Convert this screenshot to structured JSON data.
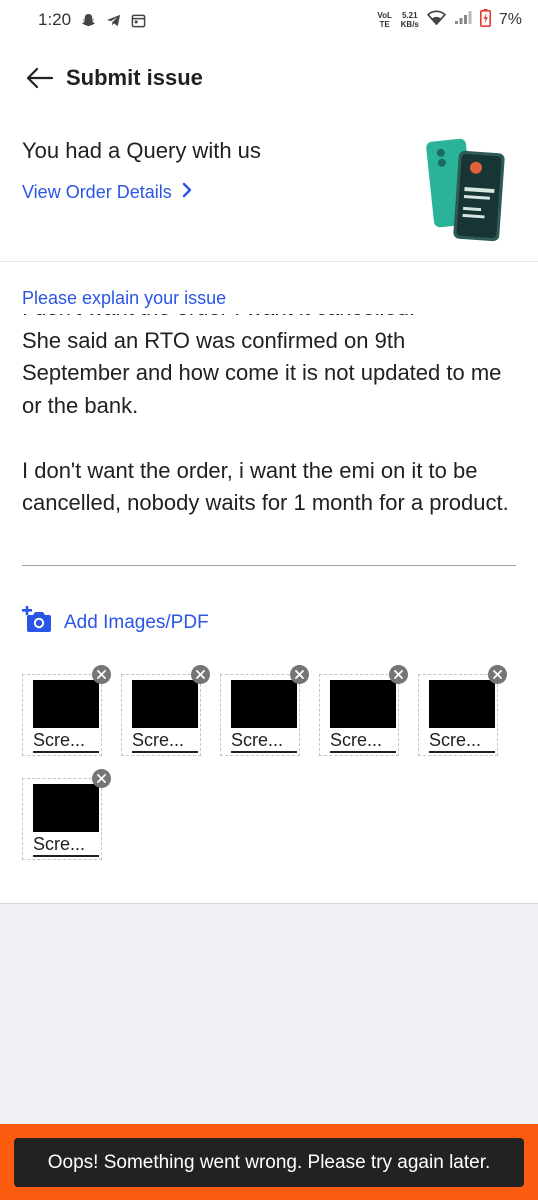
{
  "status_bar": {
    "time": "1:20",
    "network_type": "VoLTE",
    "network_speed_value": "5.21",
    "network_speed_unit": "KB/s",
    "battery_percent": "7%",
    "battery_color": "#e53935"
  },
  "header": {
    "title": "Submit issue"
  },
  "query": {
    "title": "You had a Query with us",
    "view_order_label": "View Order Details"
  },
  "issue": {
    "label": "Please explain your issue",
    "text": "I don't want the order I want it cancelled.\nShe said an RTO was confirmed on 9th September and how come it is not updated to me or the bank.\n\nI don't want the order, i want the emi on it to be cancelled, nobody waits for 1 month for a product.",
    "add_images_label": "Add Images/PDF",
    "attachments": [
      {
        "label": "Scre..."
      },
      {
        "label": "Scre..."
      },
      {
        "label": "Scre..."
      },
      {
        "label": "Scre..."
      },
      {
        "label": "Scre..."
      },
      {
        "label": "Scre..."
      }
    ]
  },
  "toast": {
    "message": "Oops! Something went wrong. Please try again later."
  },
  "colors": {
    "accent": "#2a55e5",
    "toast_border": "#fb5c0f",
    "toast_bg": "#222222"
  }
}
